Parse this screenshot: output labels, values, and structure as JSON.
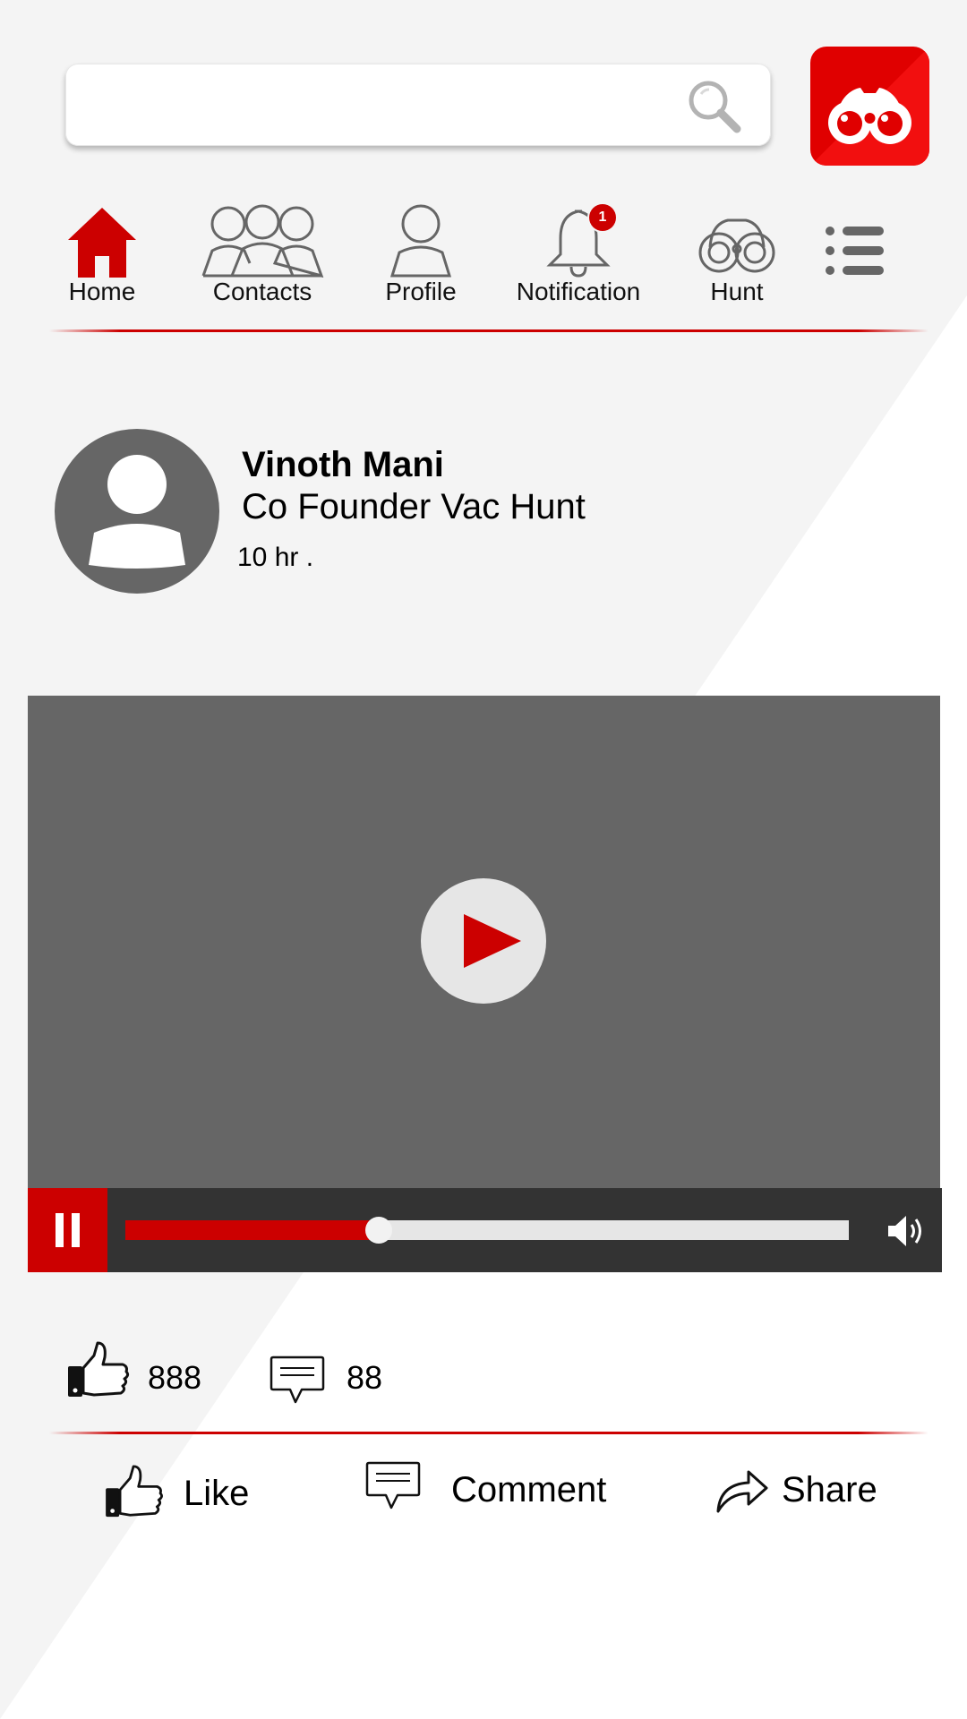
{
  "search": {
    "value": "",
    "placeholder": ""
  },
  "app": {
    "logo_icon": "binoculars-logo-icon",
    "brand_color": "#cc0000"
  },
  "nav": {
    "items": [
      {
        "label": "Home",
        "icon": "home-icon",
        "active": true
      },
      {
        "label": "Contacts",
        "icon": "contacts-icon"
      },
      {
        "label": "Profile",
        "icon": "profile-icon"
      },
      {
        "label": "Notification",
        "icon": "bell-icon",
        "badge": "1"
      },
      {
        "label": "Hunt",
        "icon": "binoculars-icon"
      }
    ],
    "menu_icon": "menu-list-icon"
  },
  "post": {
    "author": "Vinoth Mani",
    "role": "Co Founder Vac Hunt",
    "time": "10 hr ."
  },
  "video": {
    "progress": 0.35,
    "colors": {
      "frame": "#666666",
      "controls": "#333333",
      "accent": "#cc0000"
    }
  },
  "stats": {
    "likes": "888",
    "comments": "88"
  },
  "actions": {
    "like": "Like",
    "comment": "Comment",
    "share": "Share"
  }
}
